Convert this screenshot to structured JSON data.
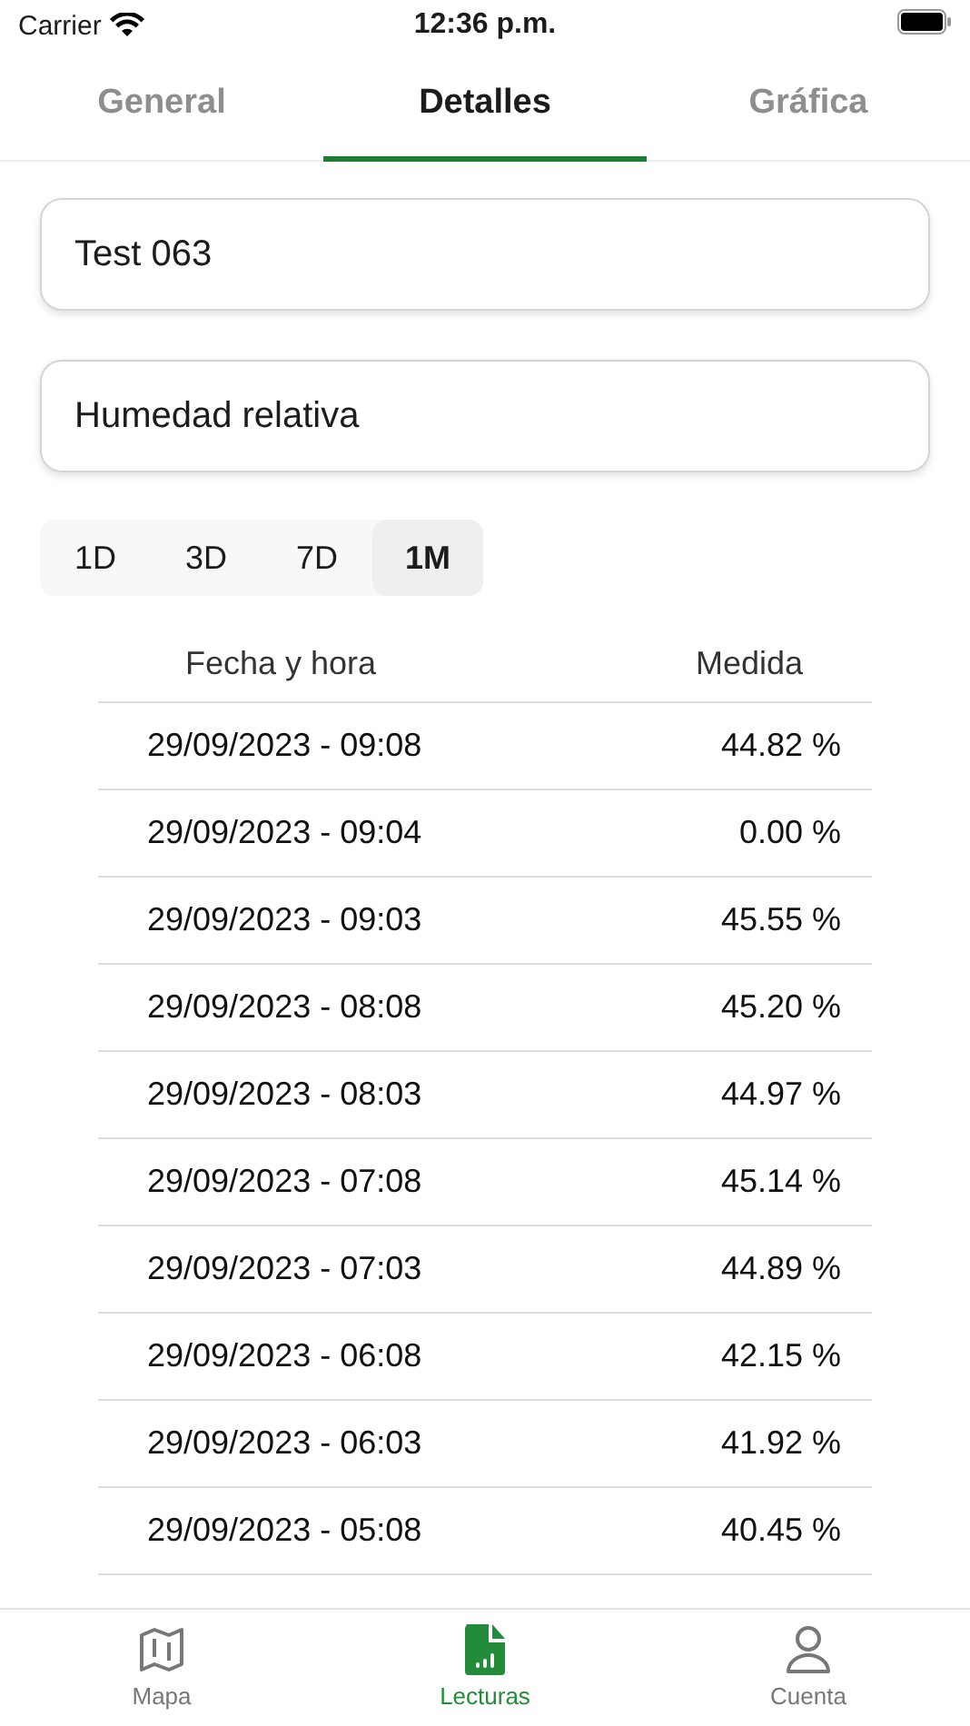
{
  "status_bar": {
    "carrier": "Carrier",
    "time": "12:36 p.m."
  },
  "tabs": [
    {
      "label": "General",
      "selected": false
    },
    {
      "label": "Detalles",
      "selected": true
    },
    {
      "label": "Gráfica",
      "selected": false
    }
  ],
  "device_field": {
    "value": "Test 063"
  },
  "variable_field": {
    "value": "Humedad relativa"
  },
  "ranges": [
    {
      "label": "1D",
      "selected": false
    },
    {
      "label": "3D",
      "selected": false
    },
    {
      "label": "7D",
      "selected": false
    },
    {
      "label": "1M",
      "selected": true
    }
  ],
  "table": {
    "columns": [
      "Fecha y hora",
      "Medida"
    ],
    "rows": [
      [
        "29/09/2023 - 09:08",
        "44.82 %"
      ],
      [
        "29/09/2023 - 09:04",
        "0.00 %"
      ],
      [
        "29/09/2023 - 09:03",
        "45.55 %"
      ],
      [
        "29/09/2023 - 08:08",
        "45.20 %"
      ],
      [
        "29/09/2023 - 08:03",
        "44.97 %"
      ],
      [
        "29/09/2023 - 07:08",
        "45.14 %"
      ],
      [
        "29/09/2023 - 07:03",
        "44.89 %"
      ],
      [
        "29/09/2023 - 06:08",
        "42.15 %"
      ],
      [
        "29/09/2023 - 06:03",
        "41.92 %"
      ],
      [
        "29/09/2023 - 05:08",
        "40.45 %"
      ]
    ]
  },
  "bottom_tabs": [
    {
      "kind": "map",
      "label": "Mapa",
      "selected": false
    },
    {
      "kind": "readings",
      "label": "Lecturas",
      "selected": true
    },
    {
      "kind": "account",
      "label": "Cuenta",
      "selected": false
    }
  ]
}
